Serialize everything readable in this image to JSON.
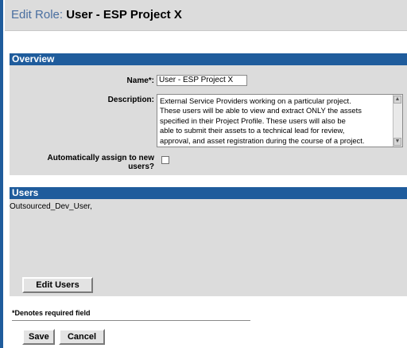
{
  "header": {
    "title_prefix": "Edit Role:",
    "title_name": "User - ESP Project X"
  },
  "overview": {
    "section_label": "Overview",
    "name_label": "Name*:",
    "name_value": "User - ESP Project X",
    "description_label": "Description:",
    "description_value": "External Service Providers working on a particular project.\nThese users will be able to view and extract ONLY the assets\nspecified in their Project Profile.  These users will also be\nable to submit their assets to a technical lead for review,\napproval, and asset registration during the course of a project.",
    "auto_assign_label_line1": "Automatically assign to new",
    "auto_assign_label_line2": "users?",
    "auto_assign_checked": false
  },
  "users": {
    "section_label": "Users",
    "members": "Outsourced_Dev_User,",
    "edit_button": "Edit Users"
  },
  "footer": {
    "required_note": "*Denotes required field",
    "save_button": "Save",
    "cancel_button": "Cancel"
  },
  "colors": {
    "section_header_bg": "#1f5c9c",
    "panel_bg": "#dcdcdc"
  }
}
